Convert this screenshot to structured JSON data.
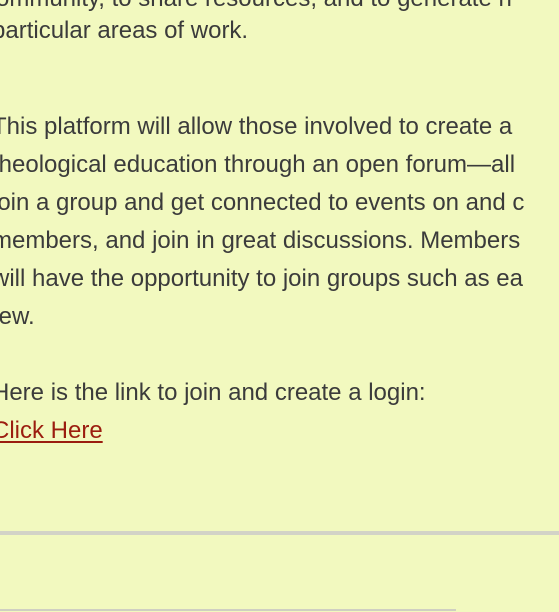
{
  "text_top_clipped": "community, to share resources, and to generate n",
  "paragraph1": {
    "lines": [
      "particular areas of work."
    ]
  },
  "paragraph2": {
    "lines": [
      "This platform will allow those involved to create a",
      "theological education through an open forum—all",
      "join a group and get connected to events on and c",
      "members, and join in great discussions. Members",
      "will have the opportunity to join groups such as ea",
      "few."
    ]
  },
  "paragraph3": {
    "intro": "Here is the link to join and create a login:",
    "link_label": "Click Here"
  }
}
